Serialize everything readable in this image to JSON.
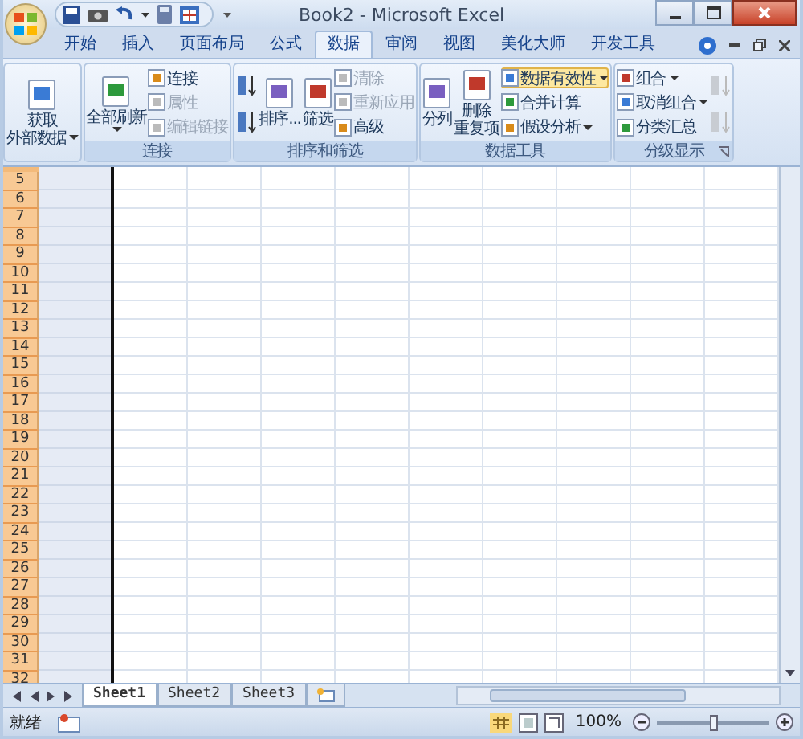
{
  "window": {
    "title": "Book2 - Microsoft Excel"
  },
  "tabs": [
    {
      "label": "开始",
      "selected": false
    },
    {
      "label": "插入",
      "selected": false
    },
    {
      "label": "页面布局",
      "selected": false
    },
    {
      "label": "公式",
      "selected": false
    },
    {
      "label": "数据",
      "selected": true
    },
    {
      "label": "审阅",
      "selected": false
    },
    {
      "label": "视图",
      "selected": false
    },
    {
      "label": "美化大师",
      "selected": false
    },
    {
      "label": "开发工具",
      "selected": false
    }
  ],
  "ribbon": {
    "groups": [
      {
        "columns": [
          [
            {
              "kind": "large",
              "lines": [
                "获取",
                "外部数据"
              ],
              "dropdown": true,
              "disabled": false,
              "highlighted": false
            }
          ]
        ]
      },
      {
        "title": "连接",
        "columns": [
          [
            {
              "kind": "large",
              "lines": [
                "全部刷新"
              ],
              "dropdown": true,
              "disabled": false,
              "highlighted": false
            }
          ],
          [
            {
              "kind": "small",
              "lines": [
                "连接"
              ],
              "dropdown": false,
              "disabled": false,
              "highlighted": false
            },
            {
              "kind": "small",
              "lines": [
                "属性"
              ],
              "dropdown": false,
              "disabled": true,
              "highlighted": false
            },
            {
              "kind": "small",
              "lines": [
                "编辑链接"
              ],
              "dropdown": false,
              "disabled": true,
              "highlighted": false
            }
          ]
        ]
      },
      {
        "title": "排序和筛选",
        "columns": [
          [
            {
              "kind": "icon",
              "disabled": false
            },
            {
              "kind": "icon",
              "disabled": false
            }
          ],
          [
            {
              "kind": "large",
              "lines": [
                "排序..."
              ],
              "dropdown": false,
              "disabled": false,
              "highlighted": false
            }
          ],
          [
            {
              "kind": "large",
              "lines": [
                "筛选"
              ],
              "dropdown": false,
              "disabled": false,
              "highlighted": false
            }
          ],
          [
            {
              "kind": "small",
              "lines": [
                "清除"
              ],
              "dropdown": false,
              "disabled": true,
              "highlighted": false
            },
            {
              "kind": "small",
              "lines": [
                "重新应用"
              ],
              "dropdown": false,
              "disabled": true,
              "highlighted": false
            },
            {
              "kind": "small",
              "lines": [
                "高级"
              ],
              "dropdown": false,
              "disabled": false,
              "highlighted": false
            }
          ]
        ]
      },
      {
        "title": "数据工具",
        "columns": [
          [
            {
              "kind": "large",
              "lines": [
                "分列"
              ],
              "dropdown": false,
              "disabled": false,
              "highlighted": false
            }
          ],
          [
            {
              "kind": "large",
              "lines": [
                "删除",
                "重复项"
              ],
              "dropdown": false,
              "disabled": false,
              "highlighted": false
            }
          ],
          [
            {
              "kind": "small",
              "lines": [
                "数据有效性"
              ],
              "dropdown": true,
              "disabled": false,
              "highlighted": true
            },
            {
              "kind": "small",
              "lines": [
                "合并计算"
              ],
              "dropdown": false,
              "disabled": false,
              "highlighted": false
            },
            {
              "kind": "small",
              "lines": [
                "假设分析"
              ],
              "dropdown": true,
              "disabled": false,
              "highlighted": false
            }
          ]
        ]
      },
      {
        "title": "分级显示",
        "launcher": true,
        "columns": [
          [
            {
              "kind": "small",
              "lines": [
                "组合"
              ],
              "dropdown": true,
              "disabled": false,
              "highlighted": false
            },
            {
              "kind": "small",
              "lines": [
                "取消组合"
              ],
              "dropdown": true,
              "disabled": false,
              "highlighted": false
            },
            {
              "kind": "small",
              "lines": [
                "分类汇总"
              ],
              "dropdown": false,
              "disabled": false,
              "highlighted": false
            }
          ],
          [
            {
              "kind": "icon",
              "disabled": true
            },
            {
              "kind": "icon",
              "disabled": true
            }
          ]
        ]
      }
    ]
  },
  "sheet": {
    "rows": [
      "5",
      "6",
      "7",
      "8",
      "9",
      "10",
      "11",
      "12",
      "13",
      "14",
      "15",
      "16",
      "17",
      "18",
      "19",
      "20",
      "21",
      "22",
      "23",
      "24",
      "25",
      "26",
      "27",
      "28",
      "29",
      "30",
      "31",
      "32"
    ]
  },
  "sheet_tabs": [
    {
      "label": "Sheet1",
      "selected": true
    },
    {
      "label": "Sheet2",
      "selected": false
    },
    {
      "label": "Sheet3",
      "selected": false
    }
  ],
  "status_bar": {
    "status": "就绪",
    "zoom": "100%",
    "zoom_slider": {
      "level": 0.5
    }
  }
}
